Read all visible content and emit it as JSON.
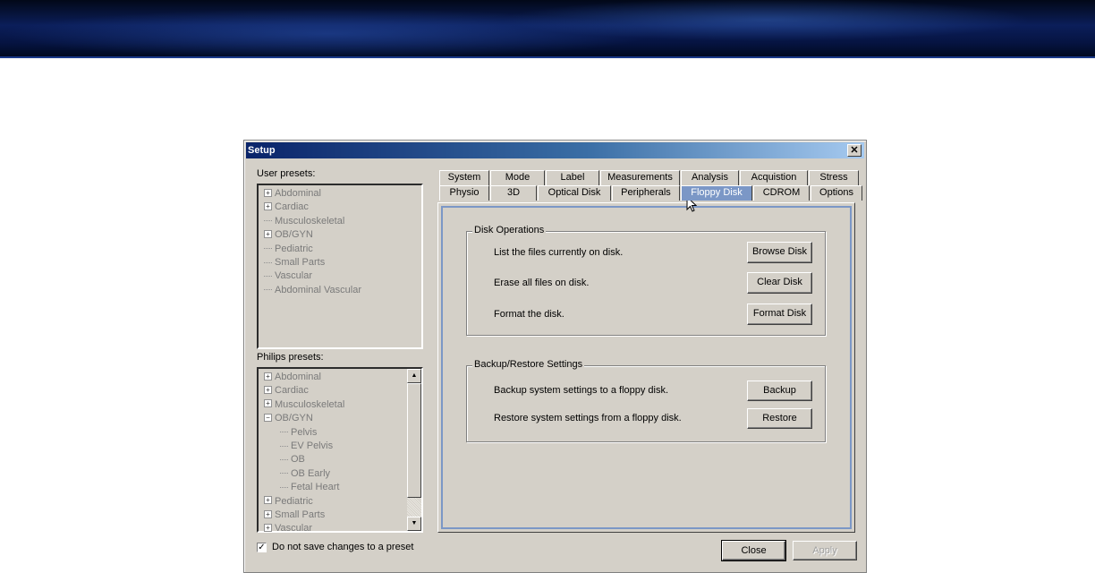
{
  "dialog": {
    "title": "Setup",
    "close_symbol": "✕"
  },
  "user_presets": {
    "label": "User presets:",
    "items": [
      {
        "label": "Abdominal",
        "expand": "+"
      },
      {
        "label": "Cardiac",
        "expand": "+"
      },
      {
        "label": "Musculoskeletal",
        "expand": ""
      },
      {
        "label": "OB/GYN",
        "expand": "+"
      },
      {
        "label": "Pediatric",
        "expand": ""
      },
      {
        "label": "Small Parts",
        "expand": ""
      },
      {
        "label": "Vascular",
        "expand": ""
      },
      {
        "label": "Abdominal Vascular",
        "expand": ""
      }
    ]
  },
  "philips_presets": {
    "label": "Philips presets:",
    "items": [
      {
        "label": "Abdominal",
        "expand": "+"
      },
      {
        "label": "Cardiac",
        "expand": "+"
      },
      {
        "label": "Musculoskeletal",
        "expand": "+"
      },
      {
        "label": "OB/GYN",
        "expand": "−"
      },
      {
        "label": "Pelvis",
        "expand": ""
      },
      {
        "label": "EV Pelvis",
        "expand": ""
      },
      {
        "label": "OB",
        "expand": ""
      },
      {
        "label": "OB Early",
        "expand": ""
      },
      {
        "label": "Fetal Heart",
        "expand": ""
      },
      {
        "label": "Pediatric",
        "expand": "+"
      },
      {
        "label": "Small Parts",
        "expand": "+"
      },
      {
        "label": "Vascular",
        "expand": "+"
      }
    ]
  },
  "tabs": {
    "row1": [
      "System",
      "Mode",
      "Label",
      "Measurements",
      "Analysis",
      "Acquistion",
      "Stress"
    ],
    "row2": [
      "Physio",
      "3D",
      "Optical Disk",
      "Peripherals",
      "Floppy Disk",
      "CDROM",
      "Options"
    ],
    "active": "Floppy Disk"
  },
  "disk_operations": {
    "title": "Disk Operations",
    "rows": [
      {
        "text": "List the files currently on disk.",
        "button": "Browse Disk"
      },
      {
        "text": "Erase all files on disk.",
        "button": "Clear Disk"
      },
      {
        "text": "Format the disk.",
        "button": "Format Disk"
      }
    ]
  },
  "backup_restore": {
    "title": "Backup/Restore Settings",
    "rows": [
      {
        "text": "Backup system settings to a floppy disk.",
        "button": "Backup"
      },
      {
        "text": "Restore system settings from a floppy disk.",
        "button": "Restore"
      }
    ]
  },
  "footer": {
    "checkbox_label": "Do not save changes to a preset",
    "checkbox_checked": true,
    "close_label": "Close",
    "apply_label": "Apply"
  },
  "colors": {
    "active_tab": "#7b97c6",
    "dialog_bg": "#d4d0c8",
    "title_start": "#0a246a"
  }
}
